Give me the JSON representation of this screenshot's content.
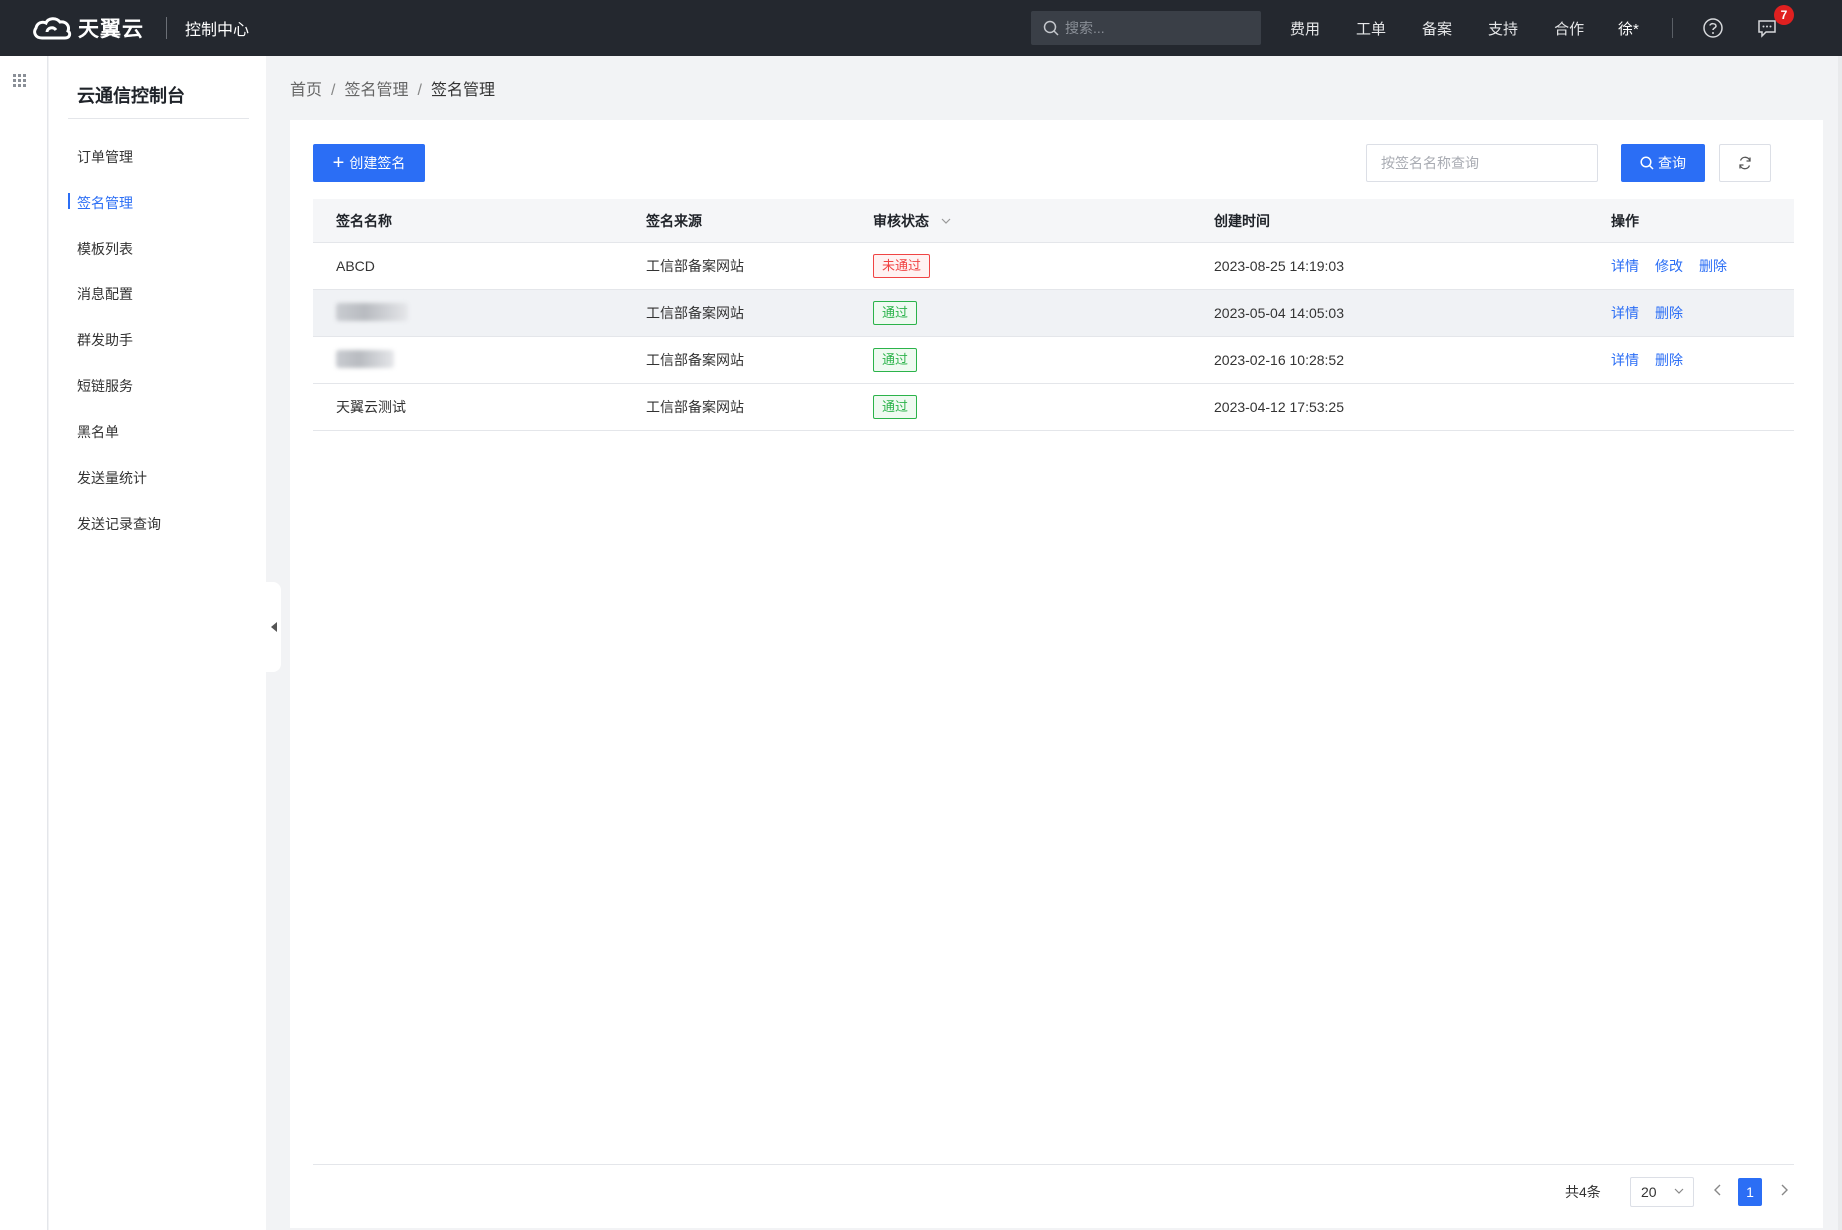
{
  "topbar": {
    "brand_name": "天翼云",
    "brand_sub": "控制中心",
    "search_placeholder": "搜索...",
    "nav": [
      "费用",
      "工单",
      "备案",
      "支持",
      "合作"
    ],
    "user": "徐*",
    "message_count": "7"
  },
  "sidebar": {
    "title": "云通信控制台",
    "items": [
      {
        "label": "订单管理"
      },
      {
        "label": "签名管理"
      },
      {
        "label": "模板列表"
      },
      {
        "label": "消息配置"
      },
      {
        "label": "群发助手"
      },
      {
        "label": "短链服务"
      },
      {
        "label": "黑名单"
      },
      {
        "label": "发送量统计"
      },
      {
        "label": "发送记录查询"
      }
    ],
    "active_index": 1
  },
  "breadcrumb": [
    "首页",
    "签名管理",
    "签名管理"
  ],
  "toolbar": {
    "create_label": "创建签名",
    "search_placeholder": "按签名名称查询",
    "query_label": "查询"
  },
  "table": {
    "columns": [
      "签名名称",
      "签名来源",
      "审核状态",
      "创建时间",
      "操作"
    ],
    "rows": [
      {
        "name": "ABCD",
        "source": "工信部备案网站",
        "status": "未通过",
        "created": "2023-08-25 14:19:03",
        "actions": [
          "详情",
          "修改",
          "删除"
        ]
      },
      {
        "name": "",
        "source": "工信部备案网站",
        "status": "通过",
        "created": "2023-05-04 14:05:03",
        "actions": [
          "详情",
          "删除"
        ]
      },
      {
        "name": "",
        "source": "工信部备案网站",
        "status": "通过",
        "created": "2023-02-16 10:28:52",
        "actions": [
          "详情",
          "删除"
        ]
      },
      {
        "name": "天翼云测试",
        "source": "工信部备案网站",
        "status": "通过",
        "created": "2023-04-12 17:53:25",
        "actions": []
      }
    ]
  },
  "pagination": {
    "total": "共4条",
    "page_size": "20",
    "current_page": "1"
  },
  "colors": {
    "primary": "#2b6ef5",
    "topbar": "#24282f",
    "fail": "#f04444",
    "pass": "#2bb34a"
  }
}
